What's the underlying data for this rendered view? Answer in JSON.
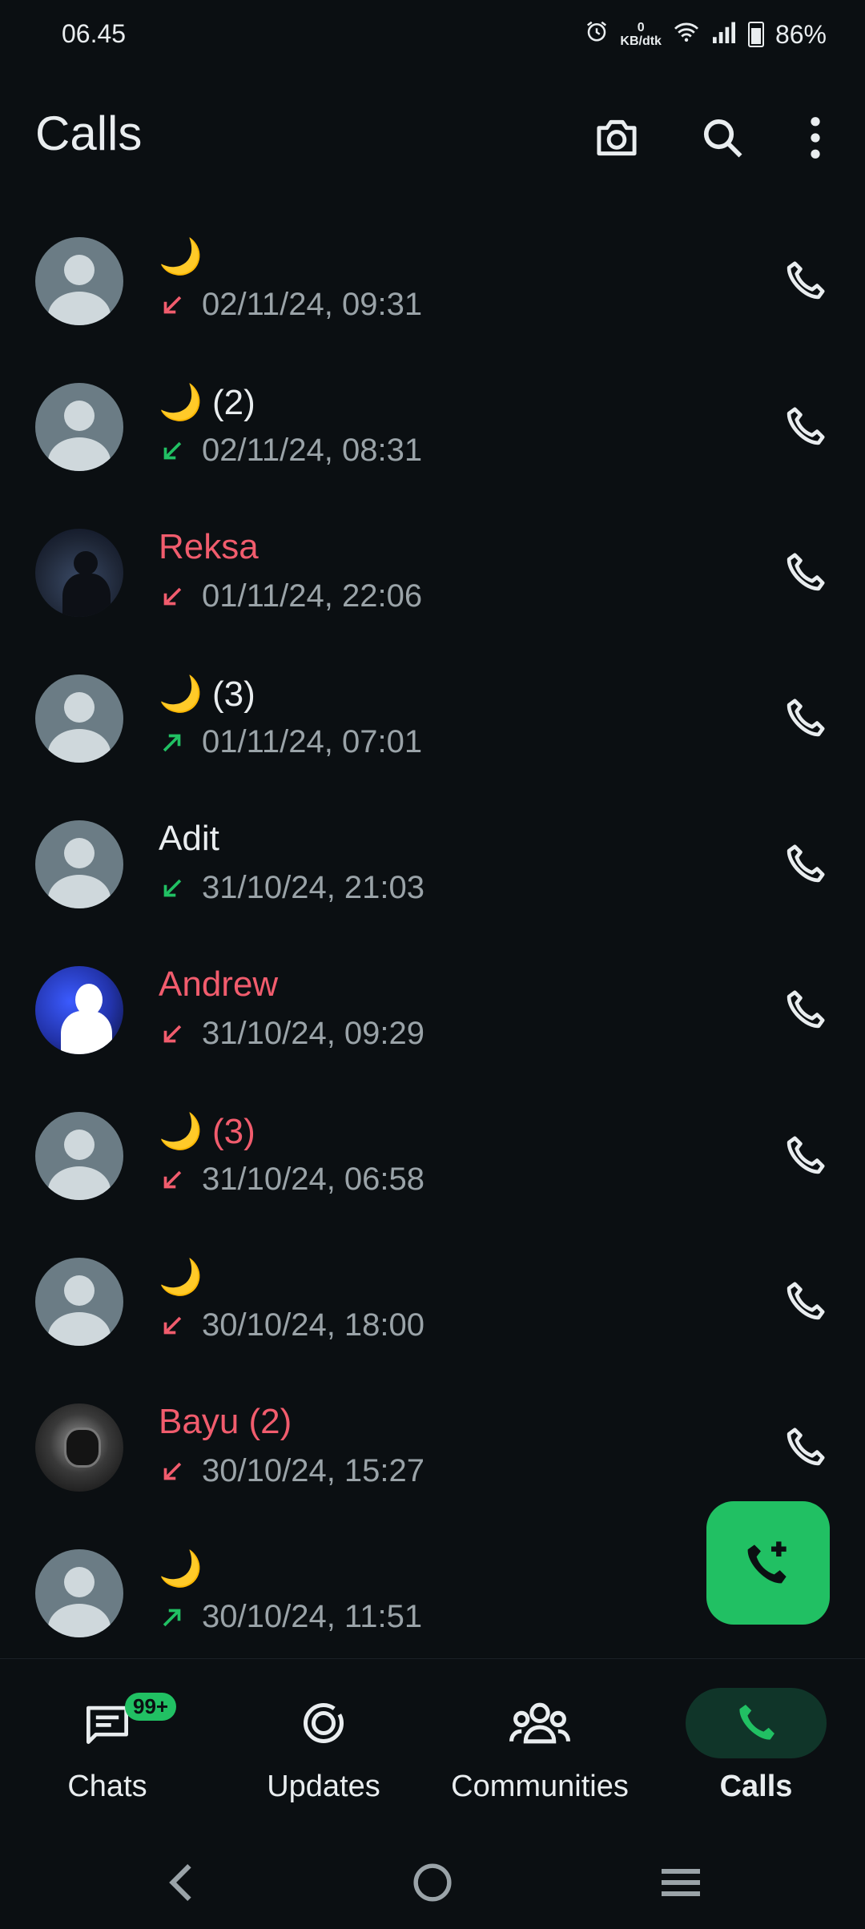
{
  "status_bar": {
    "time": "06.45",
    "kb_value": "0",
    "kb_unit": "KB/dtk",
    "battery": "86%"
  },
  "header": {
    "title": "Calls",
    "icons": [
      "camera-icon",
      "search-icon",
      "more-vert-icon"
    ]
  },
  "calls": [
    {
      "name": "🌙",
      "missed": false,
      "direction": "incoming-missed",
      "time": "02/11/24, 09:31"
    },
    {
      "name": "🌙 (2)",
      "missed": false,
      "direction": "incoming",
      "time": "02/11/24, 08:31"
    },
    {
      "name": "Reksa",
      "missed": true,
      "direction": "incoming-missed",
      "time": "01/11/24, 22:06"
    },
    {
      "name": "🌙 (3)",
      "missed": false,
      "direction": "outgoing",
      "time": "01/11/24, 07:01"
    },
    {
      "name": "Adit",
      "missed": false,
      "direction": "incoming",
      "time": "31/10/24, 21:03"
    },
    {
      "name": "Andrew",
      "missed": true,
      "direction": "incoming-missed",
      "time": "31/10/24, 09:29"
    },
    {
      "name": "🌙 (3)",
      "missed": true,
      "direction": "incoming-missed",
      "time": "31/10/24, 06:58"
    },
    {
      "name": "🌙",
      "missed": false,
      "direction": "incoming-missed",
      "time": "30/10/24, 18:00"
    },
    {
      "name": "Bayu (2)",
      "missed": true,
      "direction": "incoming-missed",
      "time": "30/10/24, 15:27"
    },
    {
      "name": "🌙",
      "missed": false,
      "direction": "outgoing",
      "time": "30/10/24, 11:51"
    }
  ],
  "bottom_nav": {
    "items": [
      {
        "label": "Chats",
        "badge": "99+"
      },
      {
        "label": "Updates"
      },
      {
        "label": "Communities"
      },
      {
        "label": "Calls"
      }
    ]
  },
  "colors": {
    "missed": "#f15c6d",
    "accent": "#21c063",
    "background": "#0b0f12"
  }
}
